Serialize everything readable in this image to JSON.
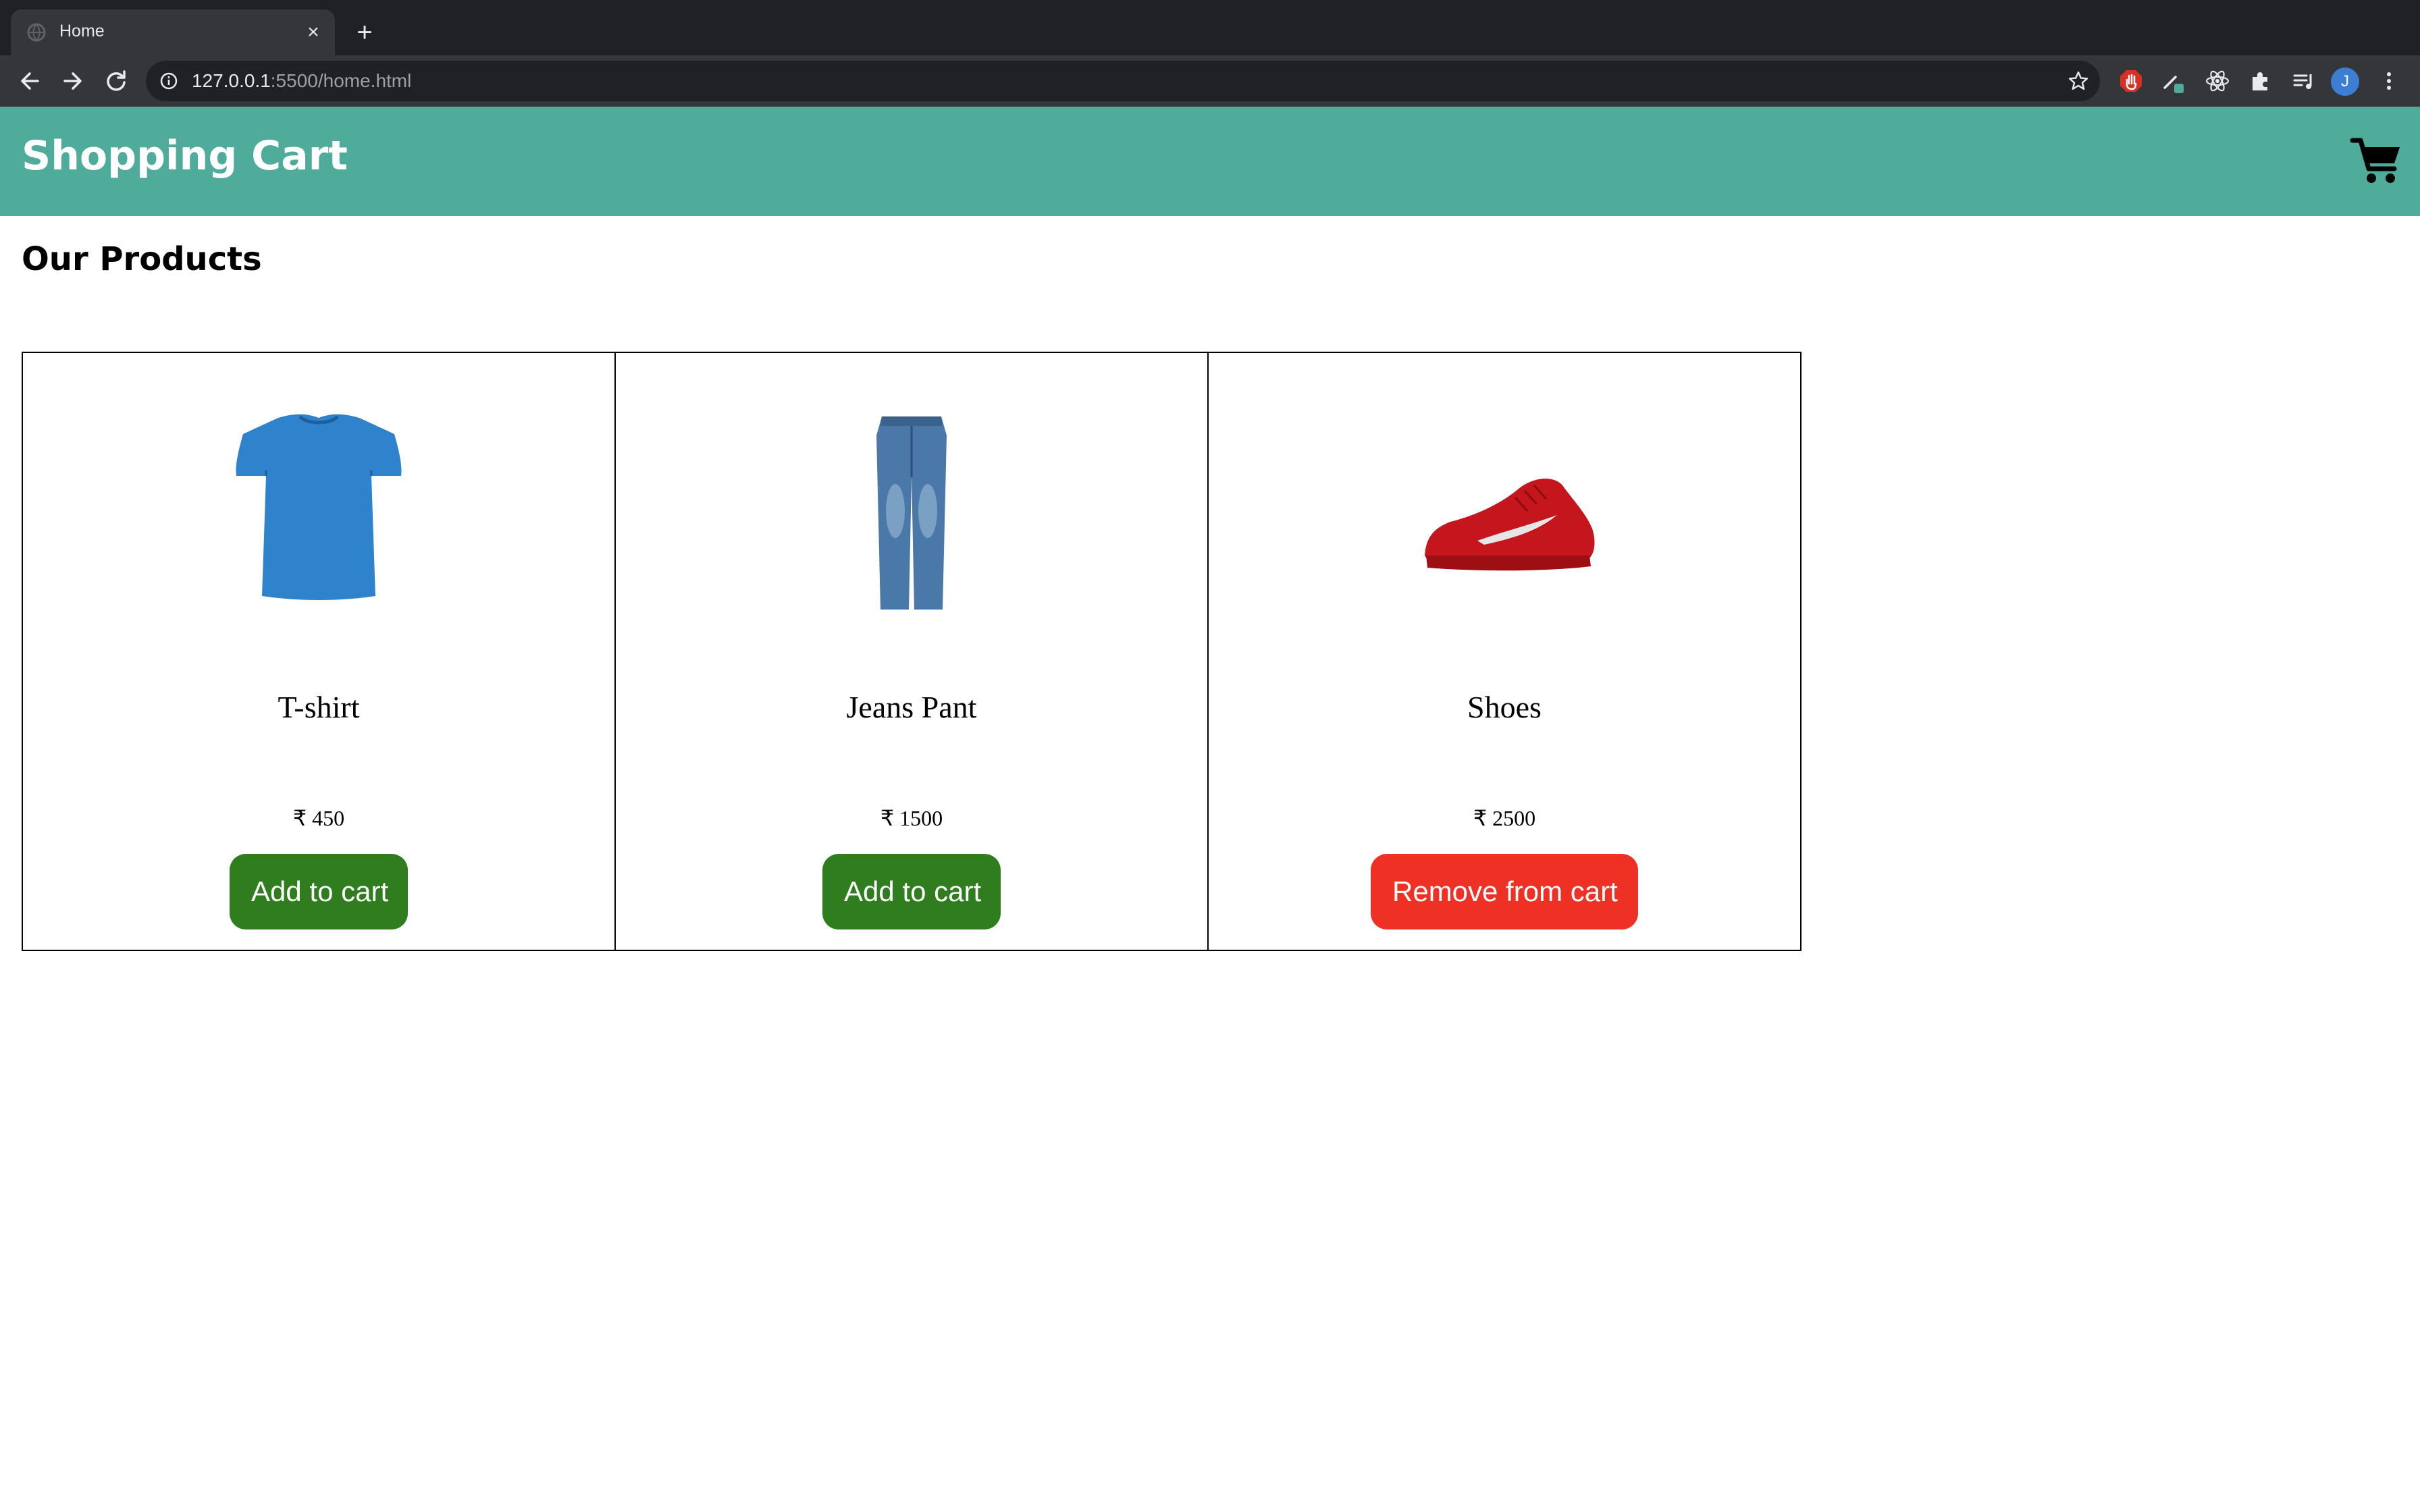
{
  "browser": {
    "tab_title": "Home",
    "tab_close": "×",
    "new_tab": "+",
    "url_host": "127.0.0.1",
    "url_rest": ":5500/home.html",
    "profile_initial": "J"
  },
  "header": {
    "title": "Shopping Cart",
    "background": "#4fac9b",
    "cart_icon": "cart-icon"
  },
  "section": {
    "title": "Our Products"
  },
  "products": [
    {
      "name": "T-shirt",
      "price": "₹ 450",
      "button": "Add to cart",
      "image": "tshirt-image",
      "image_color": "#2f82cc"
    },
    {
      "name": "Jeans Pant",
      "price": "₹ 1500",
      "button": "Add to cart",
      "image": "jeans-image",
      "image_color": "#4a78a8"
    },
    {
      "name": "Shoes",
      "price": "₹ 2500",
      "button": "Remove from cart",
      "image": "shoes-image",
      "image_color": "#c4161c"
    }
  ],
  "colors": {
    "add_button": "#2f7d1e",
    "remove_button": "#ee3124"
  }
}
